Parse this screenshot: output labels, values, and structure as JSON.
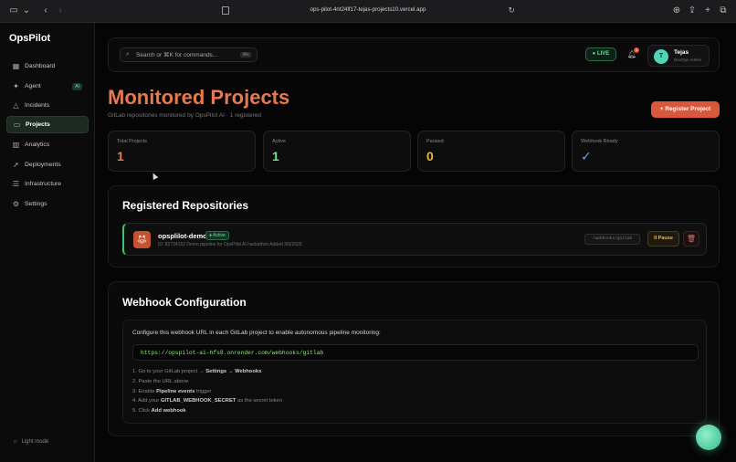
{
  "browser": {
    "url": "ops-pilot-4nt24lf17-tejas-projects10.vercel.app"
  },
  "sidebar": {
    "brand": "OpsPilot",
    "items": [
      {
        "label": "Dashboard",
        "icon": "grid-icon"
      },
      {
        "label": "Agent",
        "icon": "sparkle-icon",
        "badge": "AI"
      },
      {
        "label": "Incidents",
        "icon": "warning-icon"
      },
      {
        "label": "Projects",
        "icon": "folder-icon",
        "active": true
      },
      {
        "label": "Analytics",
        "icon": "chart-icon"
      },
      {
        "label": "Deployments",
        "icon": "rocket-icon"
      },
      {
        "label": "Infrastructure",
        "icon": "server-icon"
      },
      {
        "label": "Settings",
        "icon": "gear-icon"
      }
    ],
    "light_mode": "Light mode"
  },
  "topbar": {
    "search_placeholder": "Search or ⌘K for commands...",
    "search_kbd": "⌘K",
    "live": "● LIVE",
    "notifications": "3",
    "user_initial": "T",
    "user_name": "Tejas",
    "user_role": "DevOps Admin"
  },
  "header": {
    "title": "Monitored Projects",
    "subtitle": "GitLab repositories monitored by OpsPilot AI · 1 registered",
    "register_button": "+ Register Project"
  },
  "stats": [
    {
      "label": "Total Projects",
      "value": "1",
      "color": "#e8794f"
    },
    {
      "label": "Active",
      "value": "1",
      "color": "#6de09a"
    },
    {
      "label": "Paused",
      "value": "0",
      "color": "#e6b94b"
    },
    {
      "label": "Webhook Ready",
      "value": "✓",
      "color": "#5aa8f0"
    }
  ],
  "registered": {
    "title": "Registered Repositories",
    "repos": [
      {
        "name": "opsplilot-demo",
        "status": "● Active",
        "meta": "ID: 82734152   Demo pipeline for OpsPilot AI hackathon   Added 3/6/2026",
        "path": "/webhooks/gitlab",
        "pause": "II Pause"
      }
    ]
  },
  "webhook": {
    "title": "Webhook Configuration",
    "intro": "Configure this webhook URL in each GitLab project to enable autonomous pipeline monitoring:",
    "url": "https://opspilot-ai-hfs8.onrender.com/webhooks/gitlab",
    "steps": [
      {
        "pre": "1. Go to your GitLab project → ",
        "bold": "Settings → Webhooks",
        "post": ""
      },
      {
        "pre": "2. Paste the URL above",
        "bold": "",
        "post": ""
      },
      {
        "pre": "3. Enable ",
        "bold": "Pipeline events",
        "post": " trigger"
      },
      {
        "pre": "4. Add your ",
        "bold": "GITLAB_WEBHOOK_SECRET",
        "post": " as the secret token"
      },
      {
        "pre": "5. Click ",
        "bold": "Add webhook",
        "post": ""
      }
    ]
  }
}
